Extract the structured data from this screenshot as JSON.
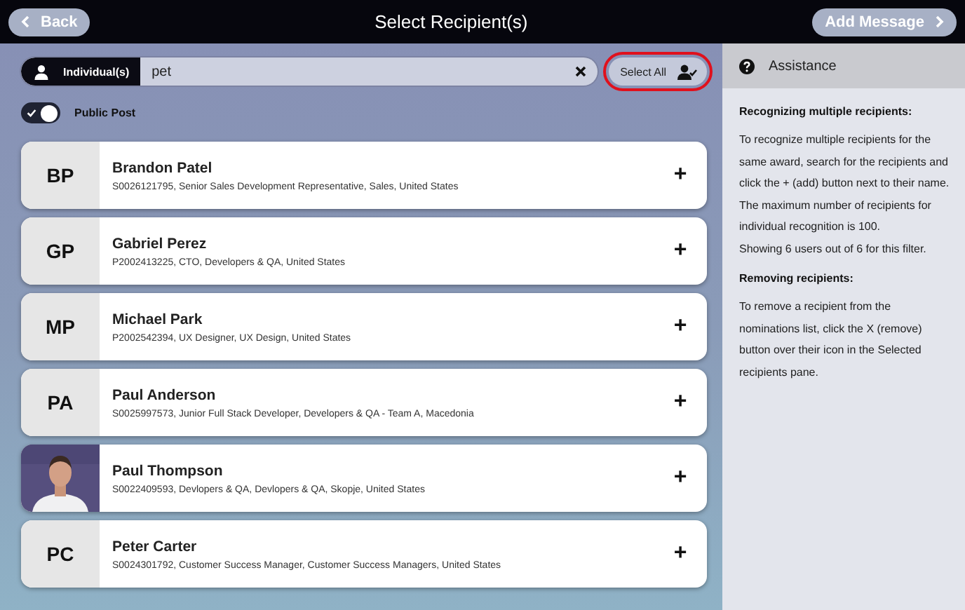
{
  "header": {
    "back": "Back",
    "title": "Select Recipient(s)",
    "next": "Add Message"
  },
  "search": {
    "mode": "Individual(s)",
    "value": "pet",
    "select_all": "Select All",
    "select_all_highlighted": true
  },
  "public_post": {
    "label": "Public Post",
    "on": true
  },
  "recipients": [
    {
      "kind": "initials",
      "initials": "BP",
      "name": "Brandon Patel",
      "details": "S0026121795, Senior Sales Development Representative, Sales, United States",
      "add": "+"
    },
    {
      "kind": "initials",
      "initials": "GP",
      "name": "Gabriel Perez",
      "details": "P2002413225, CTO, Developers & QA, United States",
      "add": "+"
    },
    {
      "kind": "initials",
      "initials": "MP",
      "name": "Michael Park",
      "details": "P2002542394, UX Designer, UX Design, United States",
      "add": "+"
    },
    {
      "kind": "initials",
      "initials": "PA",
      "name": "Paul Anderson",
      "details": "S0025997573, Junior Full Stack Developer, Developers & QA - Team A, Macedonia",
      "add": "+"
    },
    {
      "kind": "picture",
      "name": "Paul Thompson",
      "details": "S0022409593, Devlopers & QA, Devlopers & QA, Skopje, United States",
      "add": "+"
    },
    {
      "kind": "initials",
      "initials": "PC",
      "name": "Peter Carter",
      "details": "S0024301792, Customer Success Manager, Customer Success Managers, United States",
      "add": "+"
    }
  ],
  "assistance": {
    "title": "Assistance",
    "sections": [
      {
        "heading": "Recognizing multiple recipients:",
        "paragraphs": [
          "To recognize multiple recipients for the same award, search for the recipients and click the + (add) button next to their name.",
          "The maximum number of recipients for individual recognition is 100.",
          "Showing 6 users out of 6 for this filter."
        ]
      },
      {
        "heading": "Removing recipients:",
        "paragraphs": [
          "To remove a recipient from the nominations list, click the X (remove) button over their icon in the Selected recipients pane."
        ]
      }
    ]
  }
}
